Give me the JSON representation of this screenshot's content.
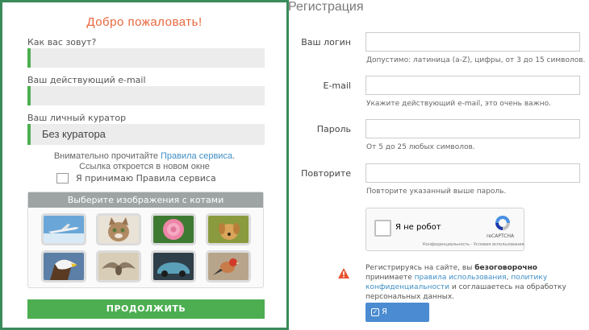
{
  "left_form": {
    "welcome": "Добро пожаловать!",
    "name_label": "Как вас зовут?",
    "email_label": "Ваш действующий e-mail",
    "curator_label": "Ваш личный куратор",
    "curator_value": "Без куратора",
    "notice_line1_prefix": "Внимательно прочитайте ",
    "notice_line1_link": "Правила сервиса",
    "notice_line1_suffix": ".",
    "notice_line2": "Ссылка откроется в новом окне",
    "accept_rules_label": "Я принимаю Правила сервиса",
    "accept_rules_checked": false,
    "captcha_title": "Выберите изображения с котами",
    "captcha_images": [
      "airplane",
      "cat",
      "pink-rose",
      "puppy",
      "eagle",
      "bird-wings",
      "car",
      "small-bird"
    ],
    "continue_label": "ПРОДОЛЖИТЬ",
    "accent_color": "#4cae50",
    "title_color": "#e8663d"
  },
  "right_form": {
    "title": "Регистрация",
    "login_label": "Ваш логин",
    "login_hint": "Допустимо: латиница (a-Z), цифры, от 3 до 15 символов.",
    "email_label": "E-mail",
    "email_hint": "Укажите действующий e-mail, это очень важно.",
    "password_label": "Пароль",
    "password_hint": "От 5 до 25 любых символов.",
    "repeat_label": "Повторите",
    "repeat_hint": "Повторите указанный выше пароль.",
    "recaptcha_label": "Я не робот",
    "recaptcha_brand": "reCAPTCHA",
    "recaptcha_terms": "Конфиденциальность - Условия использования",
    "terms_prefix": "Регистрируясь на сайте, вы ",
    "terms_bold": "безоговорочно",
    "terms_middle": " принимаете ",
    "terms_link1": "правила использования",
    "terms_sep": ", ",
    "terms_link2": "политику конфиденциальности",
    "terms_suffix": " и соглашаетесь на обработку персональных данных.",
    "agree_button": "Я согласен!",
    "button_color": "#4a8bd1",
    "warning_color": "#e8522f"
  }
}
